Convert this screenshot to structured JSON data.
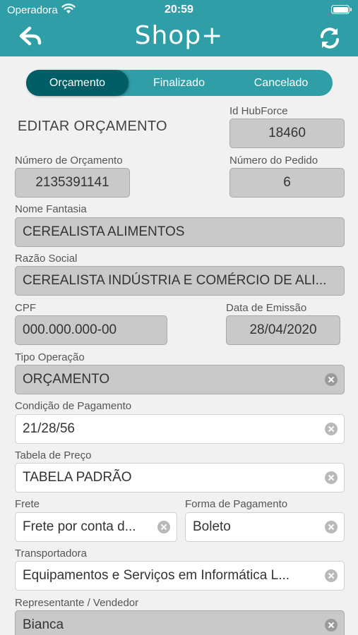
{
  "status_bar": {
    "carrier": "Operadora",
    "time": "20:59"
  },
  "header": {
    "logo": "Shop+"
  },
  "tabs": [
    {
      "label": "Orçamento",
      "active": true
    },
    {
      "label": "Finalizado",
      "active": false
    },
    {
      "label": "Cancelado",
      "active": false
    }
  ],
  "form": {
    "title": "EDITAR ORÇAMENTO",
    "id_hubforce": {
      "label": "Id HubForce",
      "value": "18460"
    },
    "numero_orcamento": {
      "label": "Número de Orçamento",
      "value": "2135391141"
    },
    "numero_pedido": {
      "label": "Número do Pedido",
      "value": "6"
    },
    "nome_fantasia": {
      "label": "Nome Fantasia",
      "value": "CEREALISTA ALIMENTOS"
    },
    "razao_social": {
      "label": "Razão Social",
      "value": "CEREALISTA INDÚSTRIA E COMÉRCIO DE ALI..."
    },
    "cpf": {
      "label": "CPF",
      "value": "000.000.000-00"
    },
    "data_emissao": {
      "label": "Data de Emissão",
      "value": "28/04/2020"
    },
    "tipo_operacao": {
      "label": "Tipo Operação",
      "value": "ORÇAMENTO"
    },
    "condicao_pagamento": {
      "label": "Condição de Pagamento",
      "value": "21/28/56"
    },
    "tabela_preco": {
      "label": "Tabela de Preço",
      "value": "TABELA PADRÃO"
    },
    "frete": {
      "label": "Frete",
      "value": "Frete por conta d..."
    },
    "forma_pagamento": {
      "label": "Forma de Pagamento",
      "value": "Boleto"
    },
    "transportadora": {
      "label": "Transportadora",
      "value": "Equipamentos e Serviços em Informática L..."
    },
    "representante": {
      "label": "Representante / Vendedor",
      "value": "Bianca"
    }
  },
  "colors": {
    "header": "#2f9ea7",
    "tab_active": "#005e66",
    "background": "#f1f1f1",
    "readonly_field": "#c9c9c9"
  },
  "icons": {
    "back": "arrow-left-icon",
    "sync": "sync-icon",
    "clear": "clear-circle-icon"
  }
}
